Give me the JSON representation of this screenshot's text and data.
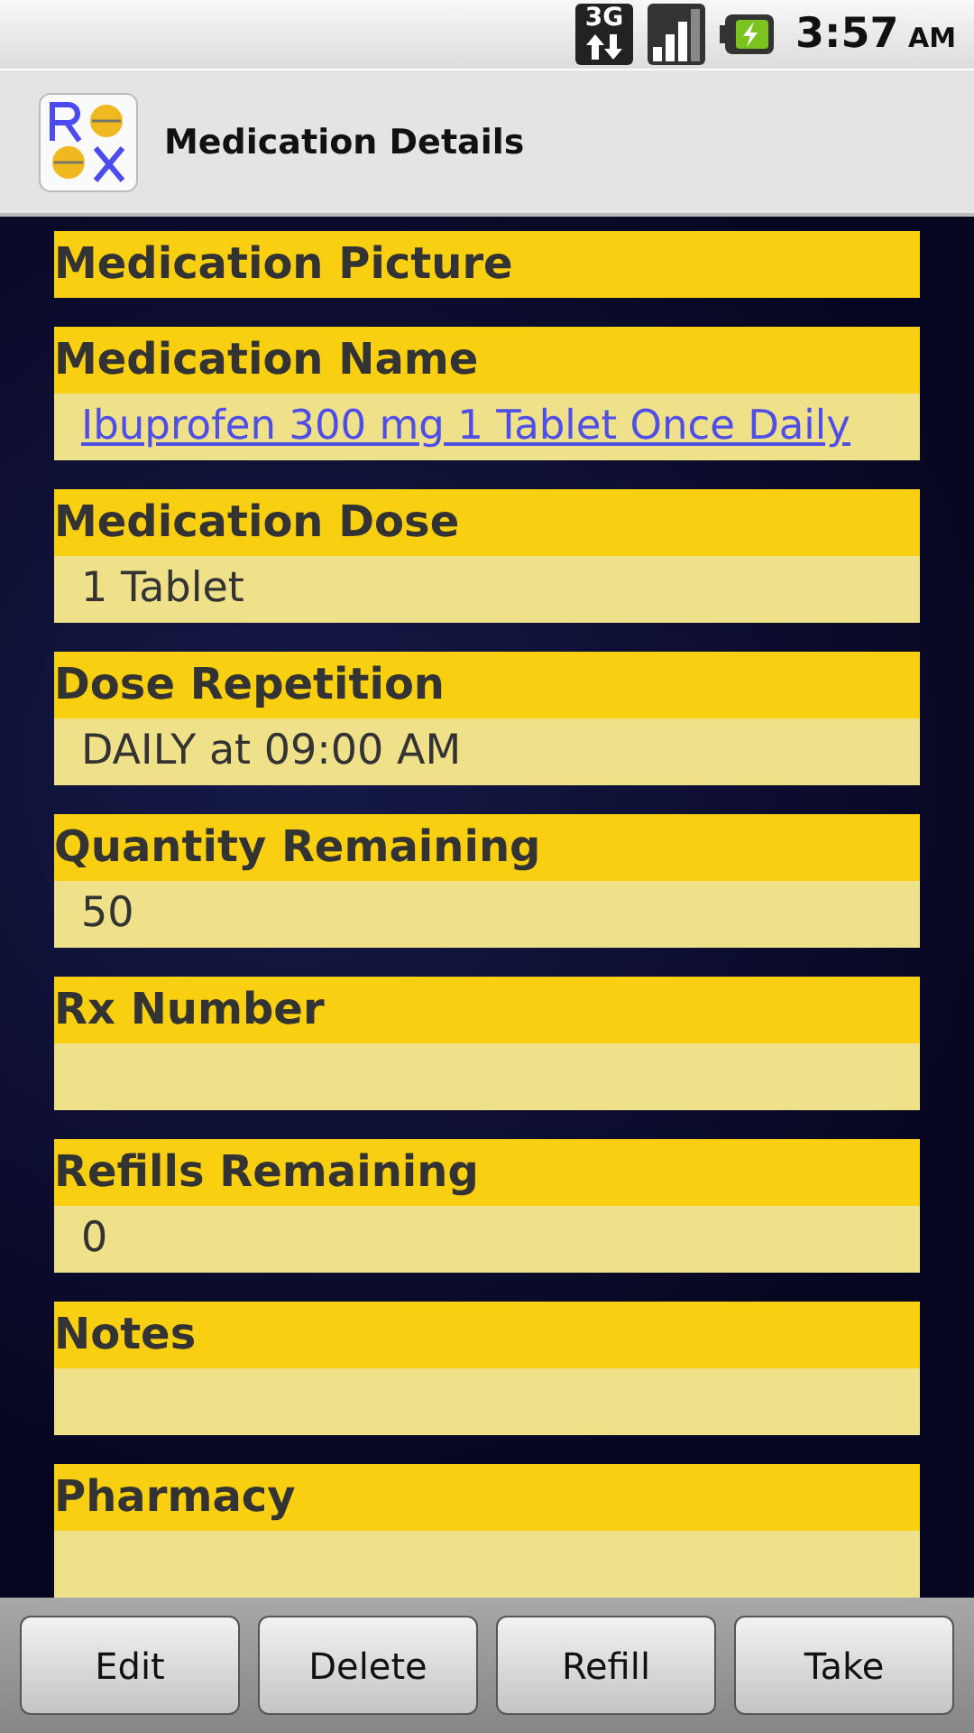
{
  "status_bar": {
    "network": "3G",
    "time": "3:57",
    "meridiem": "AM"
  },
  "app_bar": {
    "title": "Medication Details"
  },
  "fields": [
    {
      "label": "Medication Picture",
      "kind": "header_only"
    },
    {
      "label": "Medication Name",
      "kind": "link",
      "value": "Ibuprofen 300 mg 1 Tablet Once Daily"
    },
    {
      "label": "Medication Dose",
      "kind": "text",
      "value": "1 Tablet"
    },
    {
      "label": "Dose Repetition",
      "kind": "text",
      "value": "DAILY at 09:00 AM"
    },
    {
      "label": "Quantity Remaining",
      "kind": "text",
      "value": "50"
    },
    {
      "label": "Rx Number",
      "kind": "text"
    },
    {
      "label": "Refills Remaining",
      "kind": "text",
      "value": "0"
    },
    {
      "label": "Notes",
      "kind": "text"
    },
    {
      "label": "Pharmacy",
      "kind": "text"
    }
  ],
  "buttons": [
    "Edit",
    "Delete",
    "Refill",
    "Take"
  ]
}
